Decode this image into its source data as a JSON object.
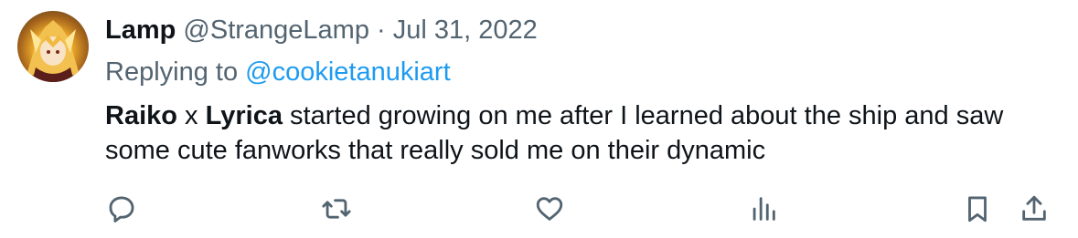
{
  "tweet": {
    "author_name": "Lamp",
    "author_handle": "@StrangeLamp",
    "separator": "·",
    "date": "Jul 31, 2022",
    "replying_prefix": "Replying to",
    "replying_to": "@cookietanukiart",
    "text_bold_1": "Raiko",
    "text_x": " x ",
    "text_bold_2": "Lyrica",
    "text_rest": " started growing on me after I learned about the ship and saw some cute fanworks that really sold me on their dynamic"
  },
  "actions": {
    "icons": [
      "reply-icon",
      "retweet-icon",
      "like-icon",
      "views-icon",
      "bookmark-icon",
      "share-icon"
    ]
  },
  "colors": {
    "text_primary": "#0f1419",
    "text_secondary": "#536471",
    "accent": "#1d9bf0"
  }
}
